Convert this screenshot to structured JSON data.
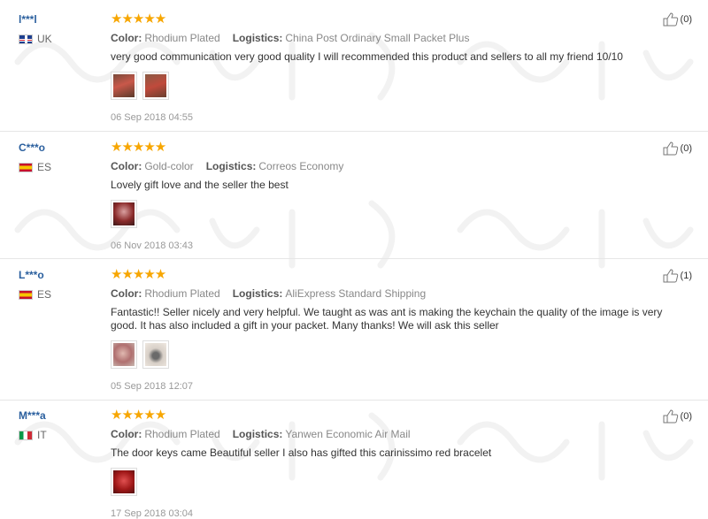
{
  "labels": {
    "color": "Color:",
    "logistics": "Logistics:"
  },
  "reviews": [
    {
      "user": "l***l",
      "country": "UK",
      "flag": "uk",
      "stars": "★★★★★",
      "color": "Rhodium Plated",
      "logistics": "China Post Ordinary Small Packet Plus",
      "text": "very good communication very good quality I will recommended this product and sellers to all my friend 10/10",
      "photos": 2,
      "date": "06 Sep 2018 04:55",
      "likes": "(0)"
    },
    {
      "user": "C***o",
      "country": "ES",
      "flag": "es",
      "stars": "★★★★★",
      "color": "Gold-color",
      "logistics": "Correos Economy",
      "text": "Lovely gift love and the seller the best",
      "photos": 1,
      "date": "06 Nov 2018 03:43",
      "likes": "(0)"
    },
    {
      "user": "L***o",
      "country": "ES",
      "flag": "es",
      "stars": "★★★★★",
      "color": "Rhodium Plated",
      "logistics": "AliExpress Standard Shipping",
      "text": "Fantastic!! Seller nicely and very helpful. We taught as was ant is making the keychain the quality of the image is very good. It has also included a gift in your packet. Many thanks! We will ask this seller",
      "photos": 2,
      "date": "05 Sep 2018 12:07",
      "likes": "(1)"
    },
    {
      "user": "M***a",
      "country": "IT",
      "flag": "it",
      "stars": "★★★★★",
      "color": "Rhodium Plated",
      "logistics": "Yanwen Economic Air Mail",
      "text": "The door keys came Beautiful seller I also has gifted this carinissimo red bracelet",
      "photos": 1,
      "date": "17 Sep 2018 03:04",
      "likes": "(0)"
    }
  ],
  "colors": {
    "star": "#f7a600",
    "username": "#2a5f9e",
    "divider": "#e6e6e6"
  }
}
